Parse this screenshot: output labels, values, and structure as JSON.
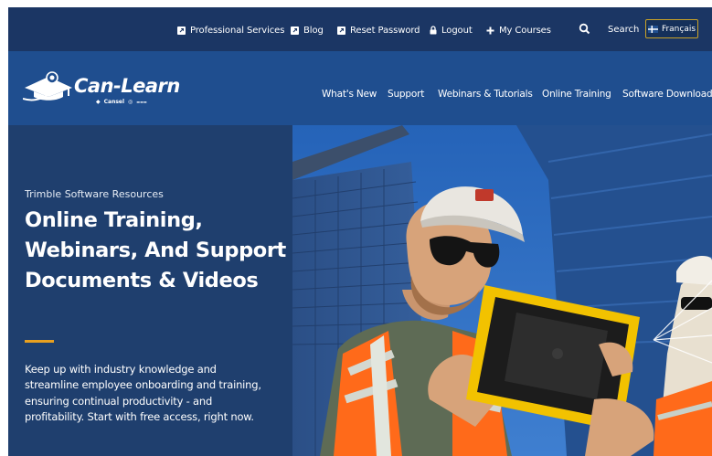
{
  "utility": {
    "links": [
      {
        "label": "Professional Services",
        "icon": "external-link-icon"
      },
      {
        "label": "Blog",
        "icon": "external-link-icon"
      },
      {
        "label": "Reset Password",
        "icon": "external-link-icon"
      },
      {
        "label": "Logout",
        "icon": "lock-icon"
      },
      {
        "label": "My Courses",
        "icon": "plus-icon"
      }
    ],
    "search_label": "Search",
    "language_button": "Français"
  },
  "brand": {
    "name": "Can-Learn",
    "sub_brand": "Cansel"
  },
  "nav": {
    "items": [
      "What's New",
      "Support",
      "Webinars & Tutorials",
      "Online Training",
      "Software Download"
    ]
  },
  "hero": {
    "eyebrow": "Trimble Software Resources",
    "title": "Online Training, Webinars, And Support Documents & Videos",
    "body": "Keep up with industry knowledge and streamline employee onboarding and training, ensuring continual productivity - and profitability. Start with free access, right now."
  },
  "colors": {
    "utility_bar": "#1b3664",
    "main_nav": "#1f4e8f",
    "hero_panel": "#1f3f6e",
    "accent": "#e8a020",
    "language_border": "#c9a227"
  }
}
